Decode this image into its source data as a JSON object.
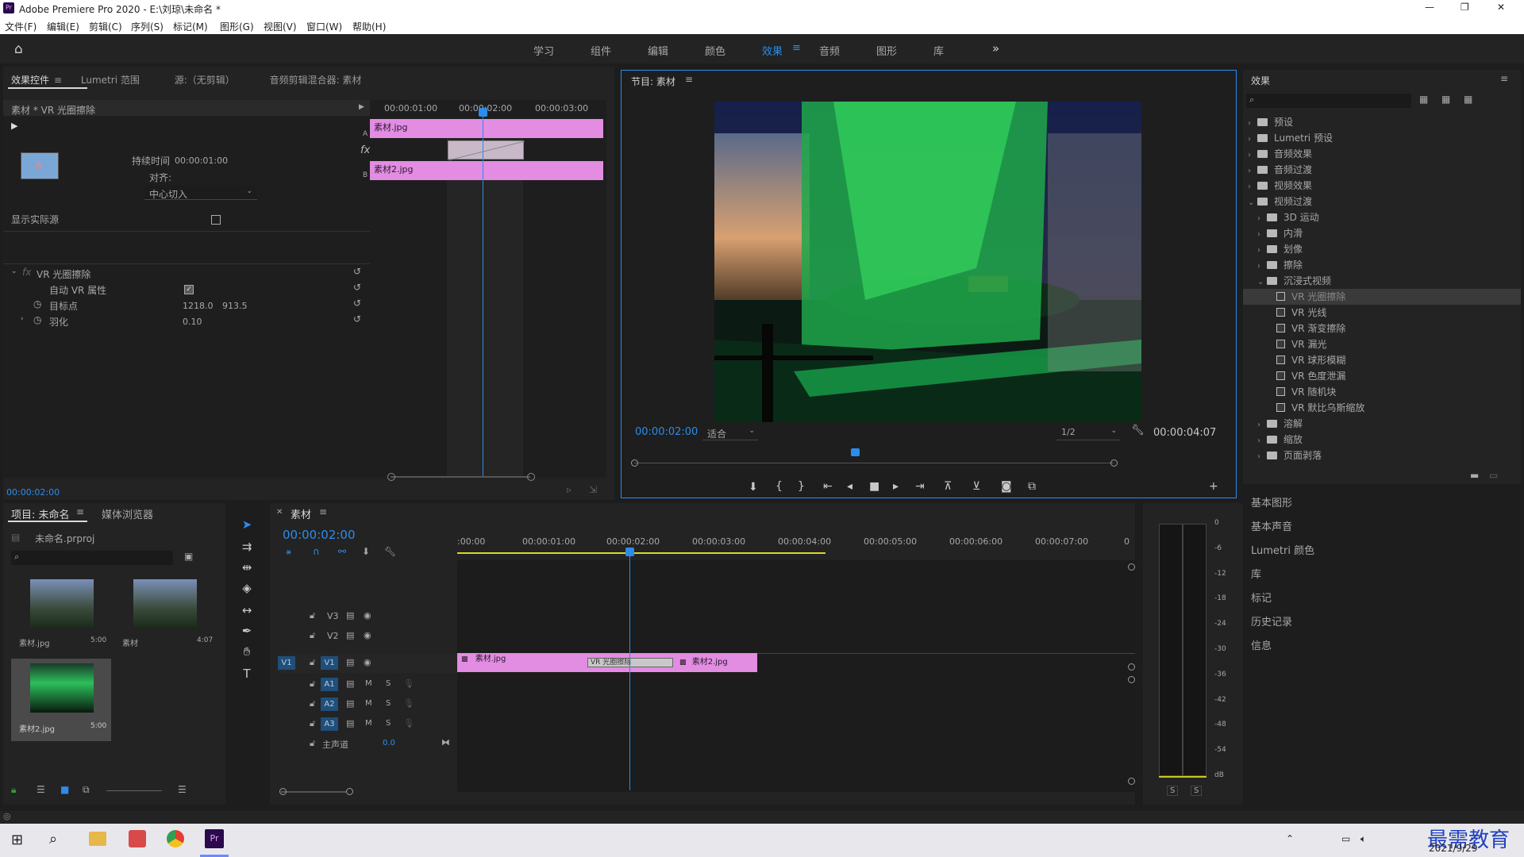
{
  "window": {
    "title": "Adobe Premiere Pro 2020 - E:\\刘琼\\未命名 *",
    "min": "—",
    "max": "❐",
    "close": "✕"
  },
  "menu": [
    "文件(F)",
    "编辑(E)",
    "剪辑(C)",
    "序列(S)",
    "标记(M)",
    "图形(G)",
    "视图(V)",
    "窗口(W)",
    "帮助(H)"
  ],
  "workspaces": [
    "学习",
    "组件",
    "编辑",
    "颜色",
    "效果",
    "音频",
    "图形",
    "库"
  ],
  "workspace_active": "效果",
  "effect_controls": {
    "tabs": [
      "效果控件",
      "Lumetri 范围",
      "源:（无剪辑）",
      "音频剪辑混合器: 素材"
    ],
    "clip_label": "素材 * VR 光圈擦除",
    "ruler": [
      "00:00:01:00",
      "00:00:02:00",
      "00:00:03:00"
    ],
    "clip_a": "素材.jpg",
    "clip_b": "素材2.jpg",
    "duration_label": "持续时间",
    "duration_value": "00:00:01:00",
    "align_label": "对齐:",
    "align_value": "中心切入",
    "show_source": "显示实际源",
    "effect_name": "VR 光圈擦除",
    "auto_vr": "自动 VR 属性",
    "target_label": "目标点",
    "target_x": "1218.0",
    "target_y": "913.5",
    "feather_label": "羽化",
    "feather_value": "0.10",
    "timecode": "00:00:02:00",
    "track_a": "A",
    "track_b": "B"
  },
  "program": {
    "title": "节目: 素材",
    "timecode": "00:00:02:00",
    "fit": "适合",
    "resolution": "1/2",
    "duration": "00:00:04:07",
    "playhead_fraction": 0.46
  },
  "effects_panel": {
    "title": "效果",
    "tree": [
      {
        "label": "预设",
        "level": 0,
        "type": "folder",
        "open": false
      },
      {
        "label": "Lumetri 预设",
        "level": 0,
        "type": "folder",
        "open": false
      },
      {
        "label": "音频效果",
        "level": 0,
        "type": "folder",
        "open": false
      },
      {
        "label": "音频过渡",
        "level": 0,
        "type": "folder",
        "open": false
      },
      {
        "label": "视频效果",
        "level": 0,
        "type": "folder",
        "open": false
      },
      {
        "label": "视频过渡",
        "level": 0,
        "type": "folder",
        "open": true
      },
      {
        "label": "3D 运动",
        "level": 1,
        "type": "folder",
        "open": false
      },
      {
        "label": "内滑",
        "level": 1,
        "type": "folder",
        "open": false
      },
      {
        "label": "划像",
        "level": 1,
        "type": "folder",
        "open": false
      },
      {
        "label": "擦除",
        "level": 1,
        "type": "folder",
        "open": false
      },
      {
        "label": "沉浸式视频",
        "level": 1,
        "type": "folder",
        "open": true
      },
      {
        "label": "VR 光圈擦除",
        "level": 2,
        "type": "fx",
        "selected": true
      },
      {
        "label": "VR 光线",
        "level": 2,
        "type": "fx"
      },
      {
        "label": "VR 渐变擦除",
        "level": 2,
        "type": "fx"
      },
      {
        "label": "VR 漏光",
        "level": 2,
        "type": "fx"
      },
      {
        "label": "VR 球形模糊",
        "level": 2,
        "type": "fx"
      },
      {
        "label": "VR 色度泄漏",
        "level": 2,
        "type": "fx"
      },
      {
        "label": "VR 随机块",
        "level": 2,
        "type": "fx"
      },
      {
        "label": "VR 默比乌斯缩放",
        "level": 2,
        "type": "fx"
      },
      {
        "label": "溶解",
        "level": 1,
        "type": "folder",
        "open": false
      },
      {
        "label": "缩放",
        "level": 1,
        "type": "folder",
        "open": false
      },
      {
        "label": "页面剥落",
        "level": 1,
        "type": "folder",
        "open": false
      }
    ],
    "side_panels": [
      "基本图形",
      "基本声音",
      "Lumetri 颜色",
      "库",
      "标记",
      "历史记录",
      "信息"
    ]
  },
  "project": {
    "tabs": [
      "项目: 未命名",
      "媒体浏览器"
    ],
    "file": "未命名.prproj",
    "items": [
      {
        "name": "素材.jpg",
        "duration": "5:00"
      },
      {
        "name": "素材",
        "duration": "4:07"
      },
      {
        "name": "素材2.jpg",
        "duration": "5:00"
      }
    ]
  },
  "timeline": {
    "title": "素材",
    "timecode": "00:00:02:00",
    "ruler": [
      ":00:00",
      "00:00:01:00",
      "00:00:02:00",
      "00:00:03:00",
      "00:00:04:00",
      "00:00:05:00",
      "00:00:06:00",
      "00:00:07:00",
      "0"
    ],
    "video_tracks": [
      "V3",
      "V2",
      "V1"
    ],
    "audio_tracks": [
      "A1",
      "A2",
      "A3"
    ],
    "source_patch": "V1",
    "master_label": "主声道",
    "master_value": "0.0",
    "clip1": "素材.jpg",
    "transition": "VR 光圈擦除",
    "clip2": "素材2.jpg",
    "m": "M",
    "s": "S"
  },
  "meter": {
    "scale": [
      "0",
      "-6",
      "-12",
      "-18",
      "-24",
      "-30",
      "-36",
      "-42",
      "-48",
      "-54",
      "dB"
    ],
    "solo": [
      "S",
      "S"
    ]
  },
  "taskbar": {
    "date": "2021/9/29",
    "brand": "最需教育"
  }
}
